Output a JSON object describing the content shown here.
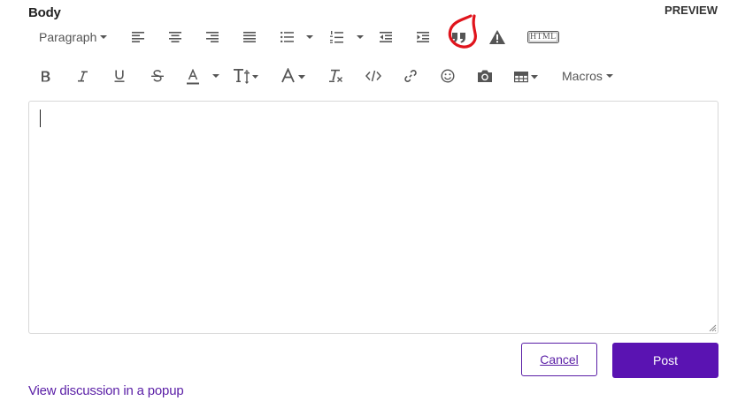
{
  "field": {
    "label": "Body",
    "preview_label": "PREVIEW"
  },
  "toolbar": {
    "format_select": "Paragraph",
    "macros_select": "Macros",
    "html_label": "HTML",
    "row1_icons": [
      "align-left-icon",
      "align-center-icon",
      "align-right-icon",
      "align-justify-icon",
      "bulleted-list-icon",
      "numbered-list-icon",
      "outdent-icon",
      "indent-icon",
      "blockquote-icon",
      "warning-icon",
      "html-source-icon"
    ],
    "row2_icons": [
      "bold-icon",
      "italic-icon",
      "underline-icon",
      "strikethrough-icon",
      "text-color-icon",
      "font-size-icon",
      "font-family-icon",
      "clear-formatting-icon",
      "code-icon",
      "link-icon",
      "emoji-icon",
      "camera-icon",
      "table-icon"
    ]
  },
  "editor": {
    "value": ""
  },
  "actions": {
    "cancel_label": "Cancel",
    "post_label": "Post"
  },
  "footer": {
    "popup_link": "View discussion in a popup"
  },
  "colors": {
    "accent": "#5a13b2",
    "annotation": "#e0141c",
    "icon": "#555555",
    "border": "#d8d8d8"
  }
}
